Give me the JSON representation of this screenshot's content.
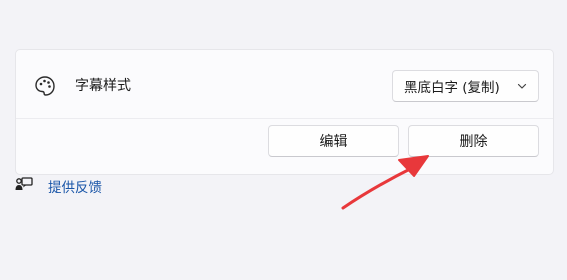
{
  "caption_style": {
    "label": "字幕样式",
    "icon": "palette-icon",
    "selected_style": "黑底白字 (复制)"
  },
  "actions": {
    "edit_label": "编辑",
    "delete_label": "删除"
  },
  "feedback": {
    "label": "提供反馈",
    "icon": "feedback-icon"
  },
  "colors": {
    "link": "#1a56a8",
    "annotation_arrow": "#e8383b"
  }
}
